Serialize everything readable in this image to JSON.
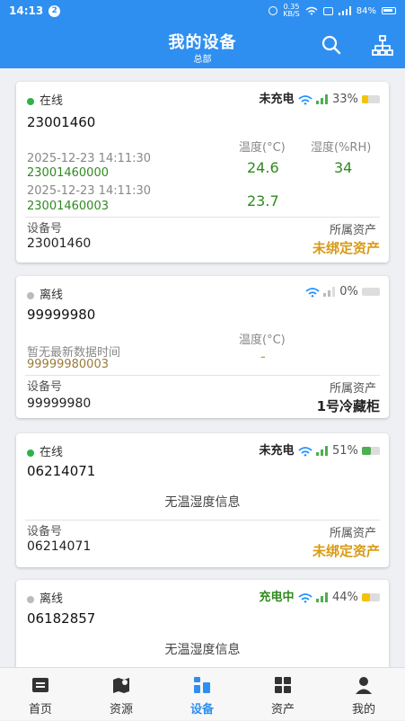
{
  "status_bar": {
    "time": "14:13",
    "notification_count": "2",
    "net_speed": "0.35",
    "net_unit": "KB/S",
    "battery": "84%"
  },
  "header": {
    "title": "我的设备",
    "subtitle": "总部"
  },
  "labels": {
    "device_no": "设备号",
    "asset": "所属资产"
  },
  "devices": [
    {
      "status": "在线",
      "status_color": "#2db24a",
      "charge": "未充电",
      "charge_color": "#222222",
      "battery_pct": "33%",
      "battery_level": 0.33,
      "battery_color": "#f4c20d",
      "id": "23001460",
      "temp_header": "温度(°C)",
      "hum_header": "湿度(%RH)",
      "sensors": [
        {
          "time": "2025-12-23 14:11:30",
          "sensor_id": "23001460000",
          "temp": "24.6",
          "hum": "34"
        },
        {
          "time": "2025-12-23 14:11:30",
          "sensor_id": "23001460003",
          "temp": "23.7"
        }
      ],
      "device_no": "23001460",
      "asset": "未绑定资产",
      "asset_color": "#d99a14"
    },
    {
      "status": "离线",
      "status_color": "#bbbbbb",
      "battery_pct": "0%",
      "battery_level": 0.0,
      "battery_color": "#cccccc",
      "id": "99999980",
      "temp_header": "温度(°C)",
      "no_data_time": "暂无最新数据时间",
      "sensor_id": "99999980003",
      "temp": "-",
      "device_no": "99999980",
      "asset": "1号冷藏柜",
      "asset_color": "#222222"
    },
    {
      "status": "在线",
      "status_color": "#2db24a",
      "charge": "未充电",
      "charge_color": "#222222",
      "battery_pct": "51%",
      "battery_level": 0.51,
      "battery_color": "#4caf50",
      "id": "06214071",
      "no_info": "无温湿度信息",
      "device_no": "06214071",
      "asset": "未绑定资产",
      "asset_color": "#d99a14"
    },
    {
      "status": "离线",
      "status_color": "#bbbbbb",
      "charge": "充电中",
      "charge_color": "#2e8b1e",
      "battery_pct": "44%",
      "battery_level": 0.44,
      "battery_color": "#f4c20d",
      "id": "06182857",
      "no_info": "无温湿度信息"
    }
  ],
  "tabs": [
    {
      "label": "首页",
      "icon": "home-icon"
    },
    {
      "label": "资源",
      "icon": "map-pin-icon"
    },
    {
      "label": "设备",
      "icon": "device-icon",
      "active": true
    },
    {
      "label": "资产",
      "icon": "grid-icon"
    },
    {
      "label": "我的",
      "icon": "user-icon"
    }
  ],
  "colors": {
    "primary": "#2f8ff0",
    "green": "#2e8b1e",
    "orange": "#d99a14"
  }
}
